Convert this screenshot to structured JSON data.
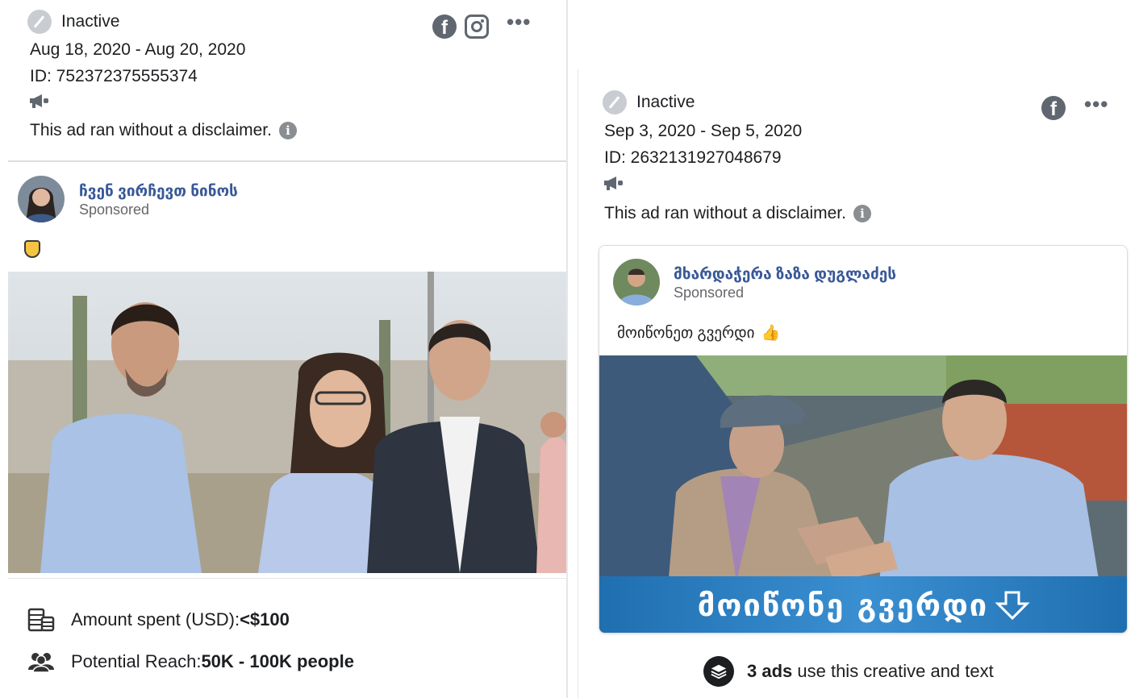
{
  "left_ad": {
    "status": "Inactive",
    "date_range": "Aug 18, 2020 - Aug 20, 2020",
    "id_text": "ID: 752372375555374",
    "disclaimer": "This ad ran without a disclaimer.",
    "platforms": [
      "facebook-icon",
      "instagram-icon"
    ],
    "page_name": "ჩვენ ვირჩევთ ნინოს",
    "sponsored": "Sponsored",
    "post_emoji": "shield-emoji",
    "stats": {
      "amount_label": "Amount spent (USD): ",
      "amount_value": "<$100",
      "reach_label": "Potential Reach: ",
      "reach_value": "50K - 100K people"
    }
  },
  "right_ad": {
    "status": "Inactive",
    "date_range": "Sep 3, 2020 - Sep 5, 2020",
    "id_text": "ID: 2632131927048679",
    "disclaimer": "This ad ran without a disclaimer.",
    "platforms": [
      "facebook-icon"
    ],
    "page_name": "მხარდაჭერა ზაზა დუგლაძეს",
    "sponsored": "Sponsored",
    "post_text": "მოიწონეთ გვერდი",
    "banner_text": "მოიწონე გვერდი",
    "reuse_count": "3 ads",
    "reuse_text": " use this creative and text"
  },
  "colors": {
    "link": "#385898",
    "muted": "#65676b",
    "icon_gray": "#606770",
    "banner": "#2a7fc4"
  }
}
